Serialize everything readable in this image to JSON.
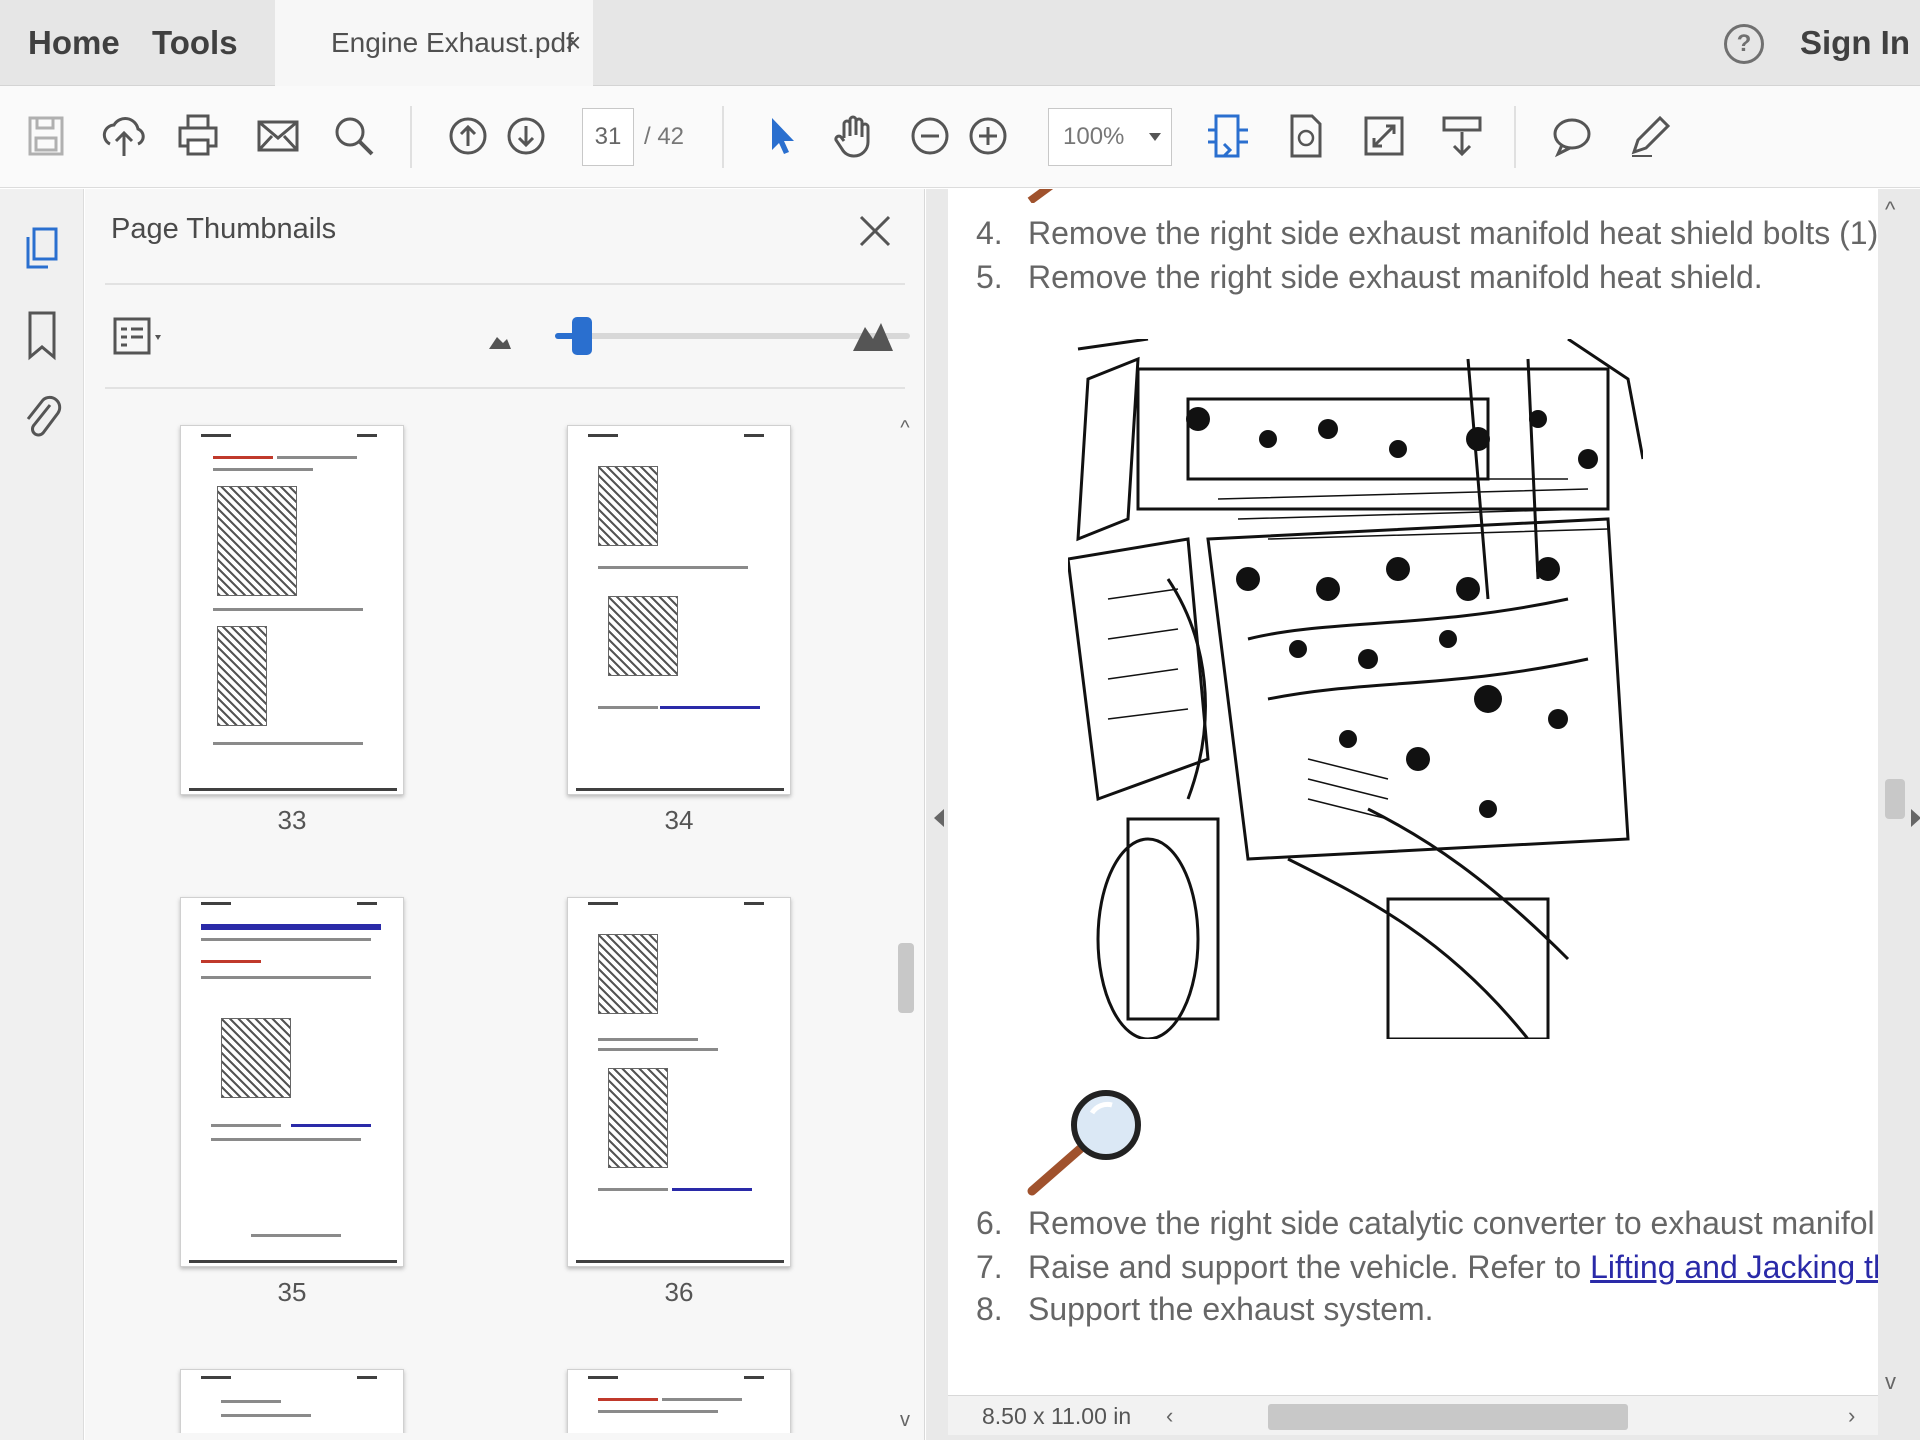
{
  "topbar": {
    "home_label": "Home",
    "tools_label": "Tools",
    "doc_tab_label": "Engine Exhaust.pdf",
    "doc_tab_close": "×",
    "help_label": "?",
    "sign_in_label": "Sign In"
  },
  "toolbar": {
    "page_current": "31",
    "page_total": "/ 42",
    "zoom_value": "100%",
    "icons": [
      "save-icon",
      "upload-icon",
      "print-icon",
      "mail-icon",
      "search-icon",
      "page-up-icon",
      "page-down-icon",
      "select-cursor-icon",
      "hand-icon",
      "zoom-out-icon",
      "zoom-in-icon",
      "fit-width-icon",
      "rotate-page-icon",
      "fullscreen-icon",
      "scroll-mode-icon",
      "comment-icon",
      "pen-icon"
    ]
  },
  "rail": {
    "icons": [
      "page-thumbnails-icon",
      "bookmark-icon",
      "attachment-icon"
    ]
  },
  "thumbnails": {
    "title": "Page Thumbnails",
    "slider_value": 0.05,
    "pages": [
      {
        "number": "33"
      },
      {
        "number": "34"
      },
      {
        "number": "35"
      },
      {
        "number": "36"
      }
    ]
  },
  "document": {
    "steps": [
      {
        "num": "4.",
        "text": "Remove the right side exhaust manifold heat shield bolts (1)"
      },
      {
        "num": "5.",
        "text": "Remove the right side exhaust manifold heat shield."
      },
      {
        "num": "6.",
        "text": "Remove the right side catalytic converter to exhaust manifol"
      },
      {
        "num": "7.",
        "text": "Raise and support the vehicle. Refer to ",
        "link": "Lifting and Jacking th"
      },
      {
        "num": "8.",
        "text": "Support the exhaust system."
      }
    ],
    "page_size": "8.50 x 11.00 in",
    "scroll_up": "^",
    "scroll_down": "v",
    "hscroll_left": "‹",
    "hscroll_right": "›"
  },
  "colors": {
    "accent": "#2a6fcf",
    "link": "#2a2aa8"
  }
}
